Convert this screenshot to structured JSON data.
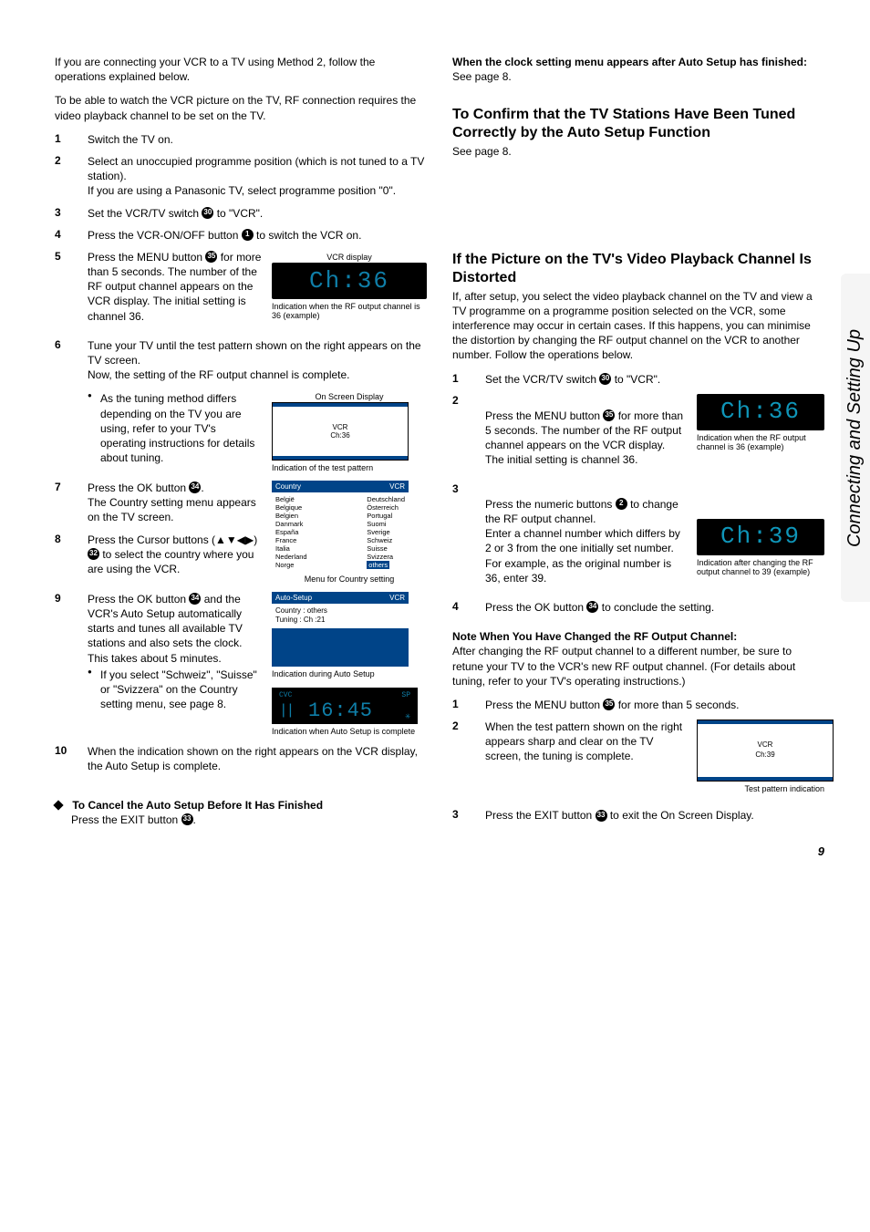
{
  "sideTab": "Connecting and Setting Up",
  "pageNumber": "9",
  "intro1": "If you are connecting your VCR to a TV using Method 2, follow the operations explained below.",
  "intro2": "To be able to watch the VCR picture on the TV, RF connection requires the video playback channel to be set on the TV.",
  "left": {
    "s1": "Switch the TV on.",
    "s2": "Select an unoccupied programme position (which is not tuned to a TV station).\nIf you are using a Panasonic TV, select programme position \"0\".",
    "s3a": "Set the VCR/TV switch ",
    "s3b": " to \"VCR\".",
    "s4a": "Press the VCR-ON/OFF button ",
    "s4b": " to switch the VCR on.",
    "s5a": "Press the MENU button ",
    "s5b": " for more than 5 seconds. The number of the RF output channel appears on the VCR display. The initial setting is channel 36.",
    "s6": "Tune your TV until the test pattern shown on the right appears on the TV screen.\nNow, the setting of the RF output channel is complete.",
    "s6bul": "As the tuning method differs depending on the TV you are using, refer to your TV's operating instructions for details about tuning.",
    "s7a": "Press the OK button ",
    "s7b": ".\nThe Country setting menu appears on the TV screen.",
    "s8a": "Press the Cursor buttons (▲▼◀▶) ",
    "s8b": " to select the country where you are using the VCR.",
    "s9a": "Press the OK button ",
    "s9b": " and the VCR's Auto Setup automatically starts and tunes all available TV stations and also sets the clock. This takes about 5 minutes.",
    "s9bul": "If you select \"Schweiz\", \"Suisse\" or \"Svizzera\" on the Country setting menu, see page 8.",
    "s10": "When the indication shown on the right appears on the VCR display, the Auto Setup is complete.",
    "cancelTitle": "To Cancel the Auto Setup Before It Has Finished",
    "cancelTextA": "Press the EXIT button ",
    "cancelTextB": "."
  },
  "badges": {
    "b1": "1",
    "b30": "30",
    "b32": "32",
    "b33": "33",
    "b34": "34",
    "b35": "35",
    "b2": "2"
  },
  "vcrDisplayLabel": "VCR display",
  "ch36": "Ch:36",
  "ch36cap": "Indication when the RF output channel is 36 (example)",
  "osdLabel": "On Screen Display",
  "osd1": {
    "l1": "VCR",
    "l2": "Ch:36"
  },
  "osd1cap": "Indication of the test pattern",
  "countryMenu": {
    "title": "Country",
    "vcr": "VCR",
    "colA": [
      "België",
      "Belgique",
      "Belgien",
      "Danmark",
      "España",
      "France",
      "Italia",
      "Nederland",
      "Norge"
    ],
    "colB": [
      "Deutschland",
      "Österreich",
      "Portugal",
      "Suomi",
      "Sverige",
      "Schweiz",
      "Suisse",
      "Svizzera"
    ],
    "others": "others"
  },
  "countryCap": "Menu for Country setting",
  "autoSetup": {
    "title": "Auto-Setup",
    "vcr": "VCR",
    "rows": [
      "Country",
      ":  others",
      "Tuning",
      ":  Ch  :21"
    ]
  },
  "autoSetupCap": "Indication during Auto Setup",
  "vcrTime": {
    "cvc": "CVC",
    "sp": "SP",
    "time": "16:45"
  },
  "vcrTimeCap": "Indication when Auto Setup is complete",
  "rightTop": {
    "clockTitle": "When the clock setting menu appears after Auto Setup has finished:",
    "seepage8a": "See page 8.",
    "h1": "To Confirm that the TV Stations Have Been Tuned Correctly by the Auto Setup Function",
    "seepage8b": "See page 8."
  },
  "distort": {
    "h": "If the Picture on the TV's Video Playback Channel Is Distorted",
    "intro": "If, after setup, you select the video playback channel on the TV and view a TV programme on a programme position selected on the VCR, some interference may occur in certain cases. If this happens, you can minimise the distortion by changing the RF output channel on the VCR to another number. Follow the operations below.",
    "s1a": "Set the VCR/TV switch ",
    "s1b": " to \"VCR\".",
    "s2a": "Press the MENU button ",
    "s2b": " for more than 5 seconds. The number of the RF output channel appears on the VCR display.\nThe initial setting is channel 36.",
    "ch36": "Ch:36",
    "ch36cap": "Indication when the RF output channel is 36 (example)",
    "s3a": "Press the numeric buttons ",
    "s3b": " to change the RF output channel.\nEnter a channel number which differs by 2 or 3 from the one initially set number. For example, as the original number is 36, enter 39.",
    "ch39": "Ch:39",
    "ch39cap": "Indication after changing the RF output channel to 39 (example)",
    "s4a": "Press the OK button ",
    "s4b": " to conclude the setting.",
    "noteTitle": "Note When You Have Changed the RF Output Channel:",
    "noteText": "After changing the RF output channel to a different number, be sure to retune your TV to the VCR's new RF output channel. (For details about tuning, refer to your TV's operating instructions.)",
    "n1a": "Press the MENU button ",
    "n1b": " for more than 5 seconds.",
    "n2": "When the test pattern shown on the right appears sharp and clear on the TV screen, the tuning is complete.",
    "osd2": {
      "l1": "VCR",
      "l2": "Ch:39"
    },
    "osd2cap": "Test pattern indication",
    "n3a": "Press the EXIT button ",
    "n3b": " to exit the On Screen Display."
  }
}
